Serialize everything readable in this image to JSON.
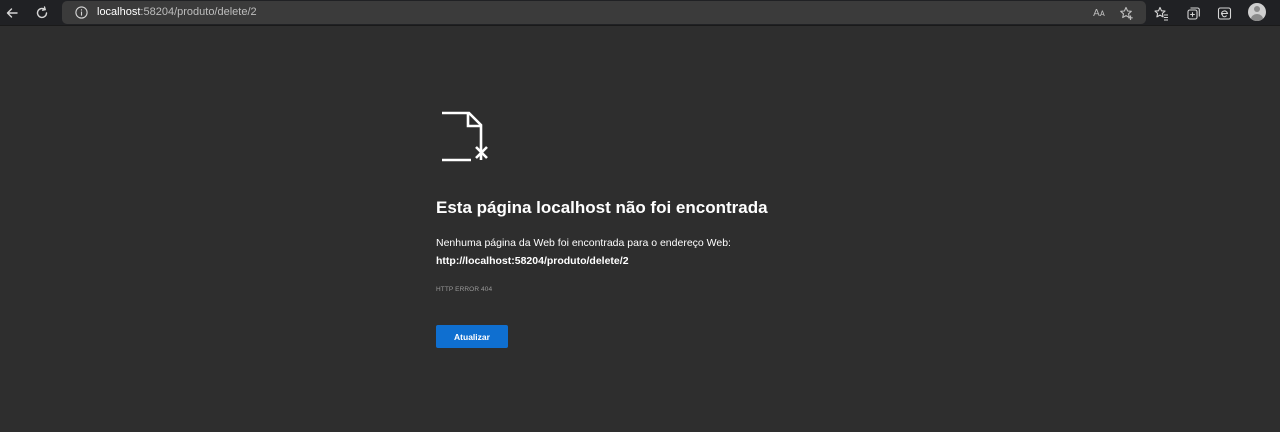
{
  "browser": {
    "address": {
      "host": "localhost",
      "rest": ":58204/produto/delete/2"
    },
    "icons": {
      "back": "back-arrow-icon",
      "refresh": "refresh-icon",
      "site_info": "info-icon",
      "read_aloud": "read-aloud-icon",
      "add_favorite": "favorite-add-icon",
      "favorites": "favorites-icon",
      "collections": "collections-icon",
      "edge": "edge-icon",
      "profile": "profile-avatar-icon"
    },
    "read_aloud_glyph": "Aᴀ"
  },
  "page": {
    "icon": "document-error-icon",
    "title": "Esta página localhost não foi encontrada",
    "description": "Nenhuma página da Web foi encontrada para o endereço Web:",
    "failed_url": "http://localhost:58204/produto/delete/2",
    "error_code": "HTTP ERROR 404",
    "reload_label": "Atualizar"
  },
  "colors": {
    "page_bg": "#2e2e2e",
    "toolbar_bg": "#202124",
    "button_blue": "#0f6fd0"
  }
}
